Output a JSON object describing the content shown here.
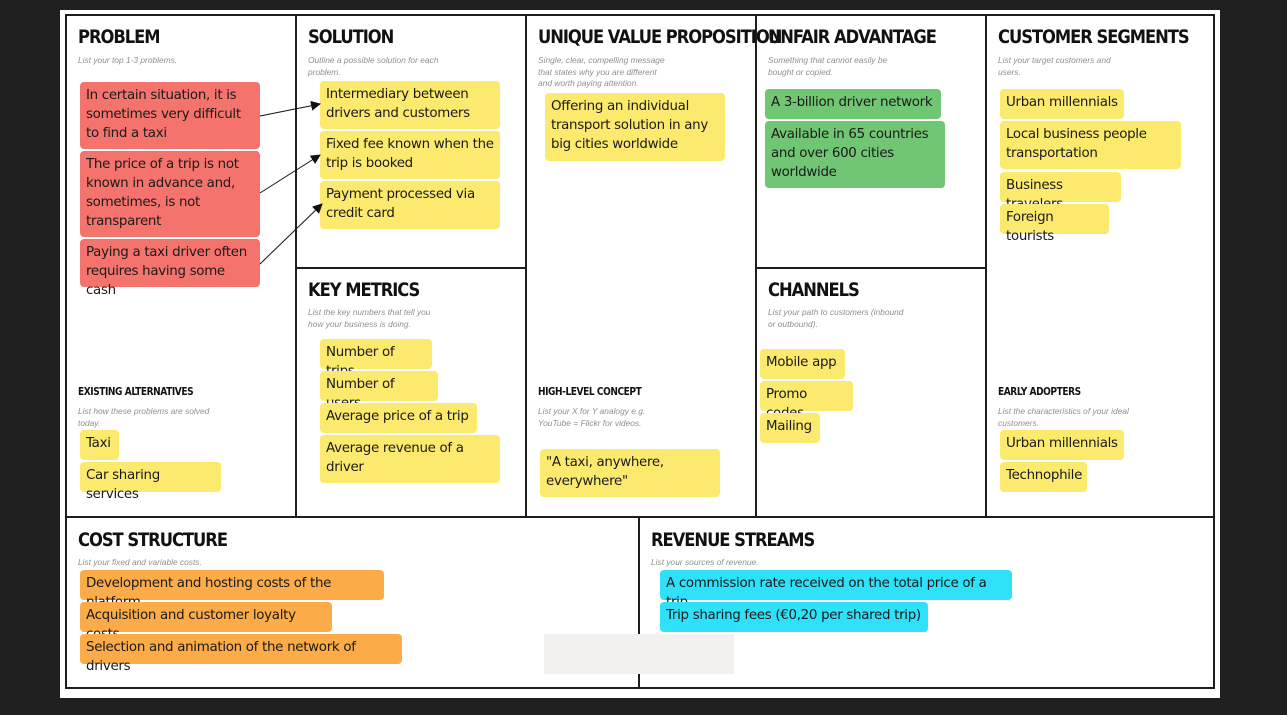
{
  "canvas": {
    "problem": {
      "title": "PROBLEM",
      "hint": "List your top 1-3 problems.",
      "notes": [
        "In certain situation, it is sometimes very difficult to find a taxi",
        "The price of a trip is not known in advance and, sometimes, is not transparent",
        "Paying a taxi driver often requires having some cash"
      ],
      "note_color": "#f5736d"
    },
    "existing_alternatives": {
      "title": "EXISTING ALTERNATIVES",
      "hint": "List how these problems are solved today.",
      "notes": [
        "Taxi",
        "Car sharing services"
      ]
    },
    "solution": {
      "title": "SOLUTION",
      "hint": "Outline a possible solution for each problem.",
      "notes": [
        "Intermediary between drivers and customers",
        "Fixed fee known when the trip is booked",
        "Payment processed via credit card"
      ]
    },
    "key_metrics": {
      "title": "KEY METRICS",
      "hint": "List the key numbers that tell you how your business is doing.",
      "notes": [
        "Number of trips",
        "Number of users",
        "Average price of a trip",
        "Average revenue of a driver"
      ]
    },
    "unique_value_proposition": {
      "title": "UNIQUE VALUE PROPOSITION",
      "hint": "Single, clear, compelling message that states why you are different and worth paying attention.",
      "notes": [
        "Offering an individual transport solution in any big cities worldwide"
      ]
    },
    "high_level_concept": {
      "title": "HIGH-LEVEL CONCEPT",
      "hint": "List your X for Y analogy e.g. YouTube = Flickr for videos.",
      "notes": [
        "\"A taxi, anywhere, everywhere\""
      ]
    },
    "unfair_advantage": {
      "title": "UNFAIR ADVANTAGE",
      "hint": "Something that cannot easily be bought or copied.",
      "notes": [
        "A 3-billion driver network",
        "Available in 65 countries and over 600 cities worldwide"
      ],
      "note_color": "#70c673"
    },
    "channels": {
      "title": "CHANNELS",
      "hint": "List your path to customers (inbound or outbound).",
      "notes": [
        "Mobile app",
        "Promo codes",
        "Mailing"
      ]
    },
    "customer_segments": {
      "title": "CUSTOMER SEGMENTS",
      "hint": "List your target customers and users.",
      "notes": [
        "Urban millennials",
        "Local business people transportation",
        "Business travelers",
        "Foreign tourists"
      ]
    },
    "early_adopters": {
      "title": "EARLY ADOPTERS",
      "hint": "List the characteristics of your ideal customers.",
      "notes": [
        "Urban millennials",
        "Technophile"
      ]
    },
    "cost_structure": {
      "title": "COST STRUCTURE",
      "hint": "List your fixed and variable costs.",
      "notes": [
        "Development and hosting costs of the platform",
        "Acquisition and customer loyalty costs",
        "Selection and animation of the network of drivers"
      ],
      "note_color": "#fcab49"
    },
    "revenue_streams": {
      "title": "REVENUE STREAMS",
      "hint": "List your sources of revenue.",
      "notes": [
        "A commission rate received on the total price of a trip",
        "Trip sharing fees (€0,20 per shared trip)"
      ],
      "note_color": "#2ee0f8"
    },
    "default_note_color": "#fcea6f",
    "arrows": [
      {
        "from": "problem.0",
        "to": "solution.0"
      },
      {
        "from": "problem.1",
        "to": "solution.1"
      },
      {
        "from": "problem.2",
        "to": "solution.2"
      }
    ]
  }
}
